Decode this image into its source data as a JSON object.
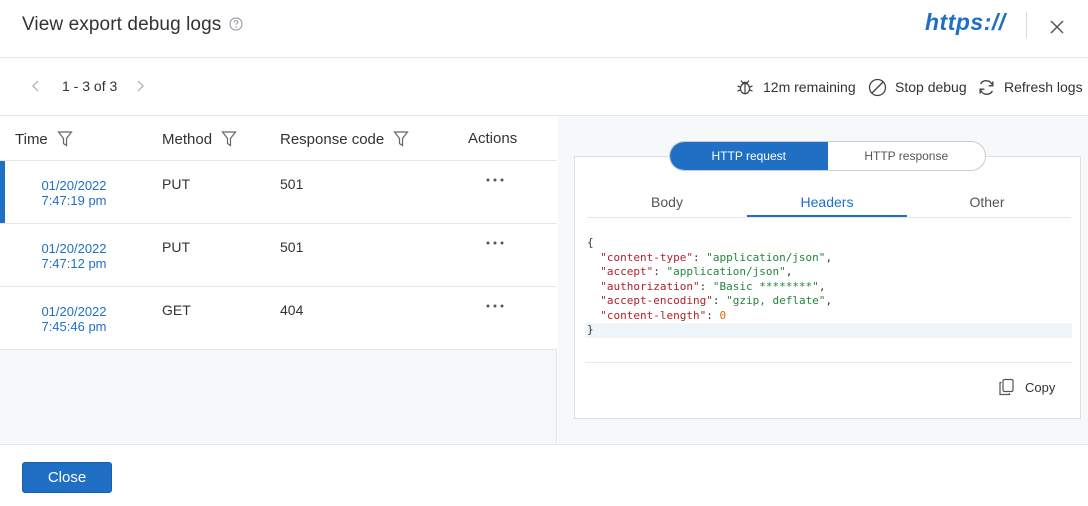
{
  "header": {
    "title": "View export debug logs",
    "brand": "https://"
  },
  "toolbar": {
    "pager": "1 - 3 of 3",
    "remaining": "12m remaining",
    "stop_debug": "Stop debug",
    "refresh_logs": "Refresh logs"
  },
  "table": {
    "columns": [
      "Time",
      "Method",
      "Response code",
      "Actions"
    ],
    "rows": [
      {
        "date": "01/20/2022",
        "time": "7:47:19 pm",
        "method": "PUT",
        "code": "501",
        "selected": true
      },
      {
        "date": "01/20/2022",
        "time": "7:47:12 pm",
        "method": "PUT",
        "code": "501",
        "selected": false
      },
      {
        "date": "01/20/2022",
        "time": "7:45:46 pm",
        "method": "GET",
        "code": "404",
        "selected": false
      }
    ]
  },
  "detail": {
    "toggle": [
      "HTTP request",
      "HTTP response"
    ],
    "active_toggle": "HTTP request",
    "tabs": [
      "Body",
      "Headers",
      "Other"
    ],
    "active_tab": "Headers",
    "headers": [
      {
        "key": "\"content-type\"",
        "value": "\"application/json\""
      },
      {
        "key": "\"accept\"",
        "value": "\"application/json\""
      },
      {
        "key": "\"authorization\"",
        "value": "\"Basic ********\""
      },
      {
        "key": "\"accept-encoding\"",
        "value": "\"gzip, deflate\""
      },
      {
        "key": "\"content-length\"",
        "value": "0"
      }
    ],
    "open_brace": "{",
    "close_brace": "}",
    "copy": "Copy"
  },
  "footer": {
    "close": "Close"
  },
  "colors": {
    "accent": "#1f6fc5",
    "json_key": "#b3212b",
    "json_string": "#22863a",
    "json_number": "#e36209"
  }
}
